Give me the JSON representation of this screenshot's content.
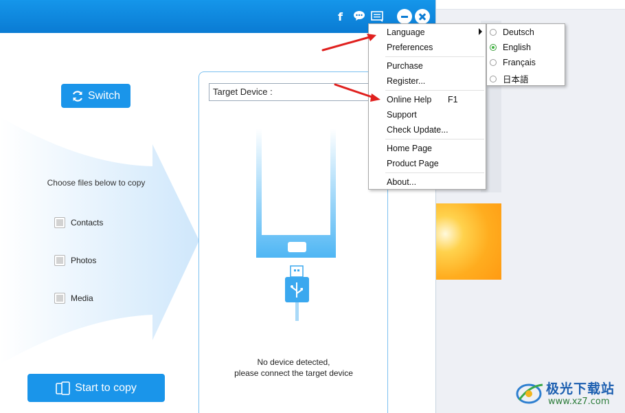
{
  "title_icons": [
    "facebook-icon",
    "chat-icon",
    "menu-icon",
    "minimize-icon",
    "close-icon"
  ],
  "facebook_glyph": "f",
  "left": {
    "switch_label": "Switch",
    "choose_label": "Choose files below to copy",
    "checkboxes": [
      {
        "label": "Contacts",
        "checked": false
      },
      {
        "label": "Photos",
        "checked": false
      },
      {
        "label": "Media",
        "checked": false
      }
    ],
    "start_copy_label": "Start to copy"
  },
  "target": {
    "select_label": "Target Device :",
    "status_line1": "No device detected,",
    "status_line2": "please connect the target device"
  },
  "menu": {
    "items": [
      {
        "label": "Language",
        "shortcut": "",
        "has_submenu": true
      },
      {
        "label": "Preferences",
        "shortcut": ""
      },
      {
        "label": "Purchase",
        "shortcut": ""
      },
      {
        "label": "Register...",
        "shortcut": ""
      },
      {
        "label": "Online Help",
        "shortcut": "F1"
      },
      {
        "label": "Support",
        "shortcut": ""
      },
      {
        "label": "Check Update...",
        "shortcut": ""
      },
      {
        "label": "Home Page",
        "shortcut": ""
      },
      {
        "label": "Product Page",
        "shortcut": ""
      },
      {
        "label": "About...",
        "shortcut": ""
      }
    ]
  },
  "languages": [
    {
      "label": "Deutsch",
      "selected": false
    },
    {
      "label": "English",
      "selected": true
    },
    {
      "label": "Français",
      "selected": false
    },
    {
      "label": "日本語",
      "selected": false
    }
  ],
  "watermark": {
    "title": "极光下载站",
    "url": "www.xz7.com"
  },
  "colors": {
    "titlebar": "#0a7bd3",
    "button": "#1a95ea",
    "annotation": "#e0201e",
    "radio_selected": "#3cb43c"
  }
}
